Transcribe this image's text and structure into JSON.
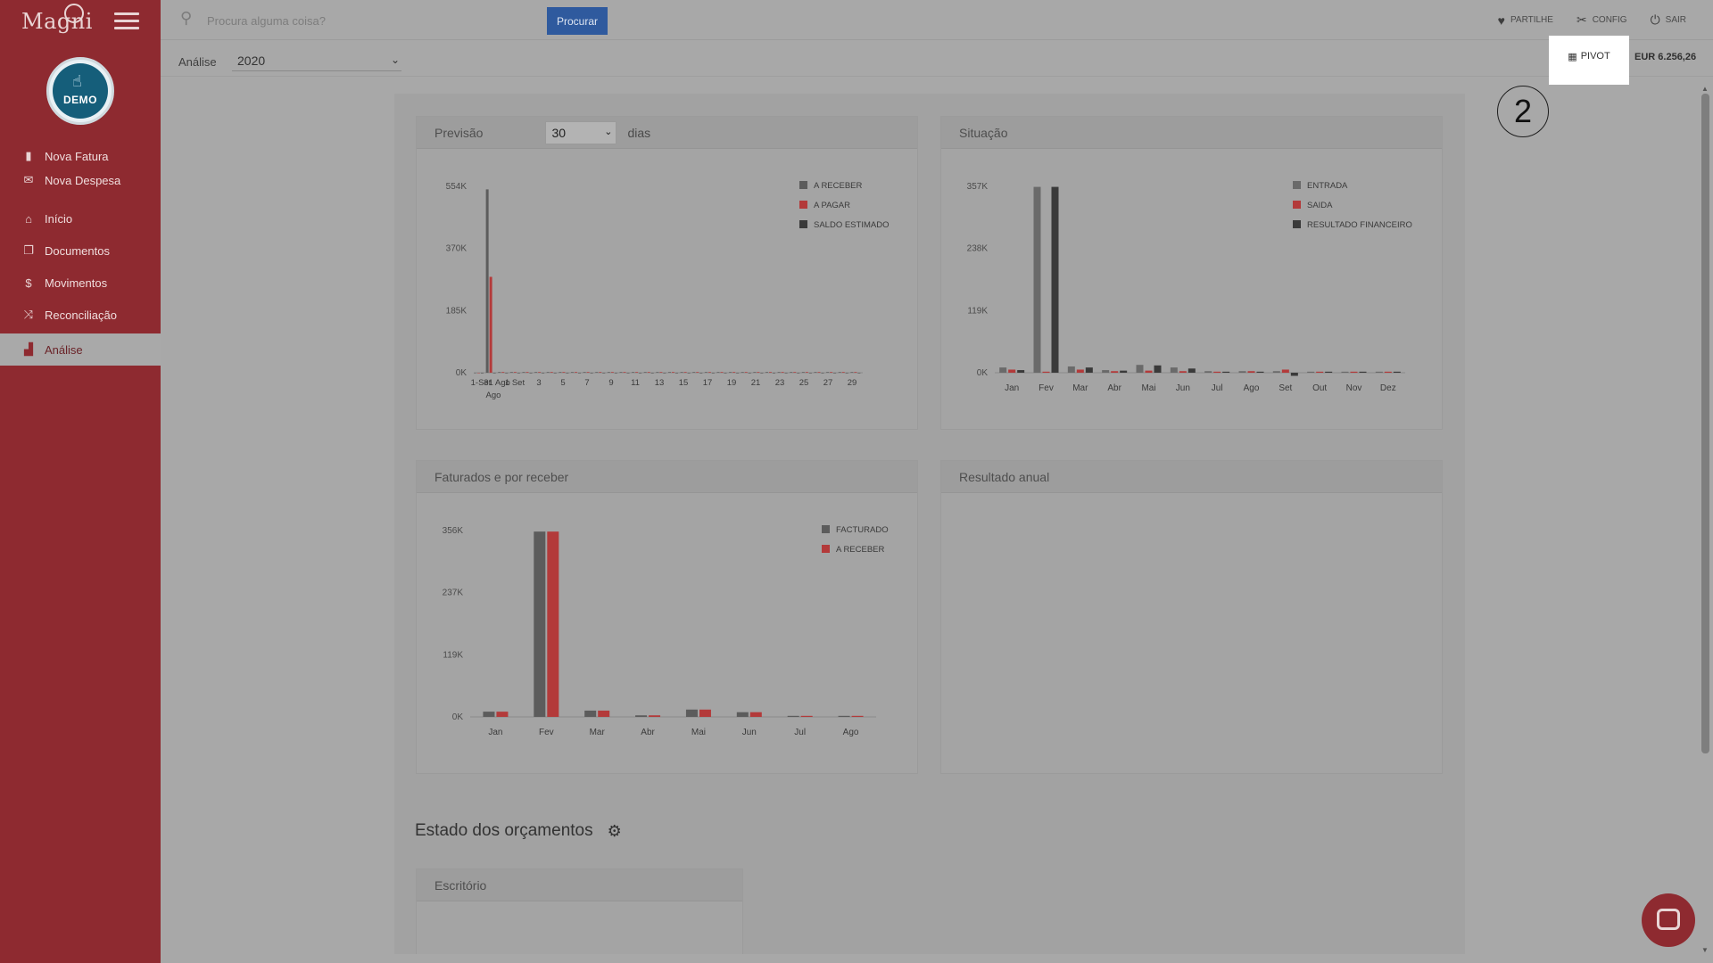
{
  "app": {
    "logo": "Magni",
    "avatar_label": "DEMO"
  },
  "sidebar": {
    "items": [
      {
        "label": "Nova Fatura",
        "icon": "document-icon"
      },
      {
        "label": "Nova Despesa",
        "icon": "receipt-icon"
      },
      {
        "label": "Início",
        "icon": "home-icon"
      },
      {
        "label": "Documentos",
        "icon": "documents-icon"
      },
      {
        "label": "Movimentos",
        "icon": "dollar-icon"
      },
      {
        "label": "Reconciliação",
        "icon": "shuffle-icon"
      },
      {
        "label": "Análise",
        "icon": "bar-chart-icon",
        "active": true
      }
    ]
  },
  "search": {
    "placeholder": "Procura alguma coisa?",
    "button": "Procurar"
  },
  "top_actions": {
    "share": "PARTILHE",
    "config": "CONFIG",
    "exit": "SAIR"
  },
  "subbar": {
    "label": "Análise",
    "year": "2020",
    "pivot": "PIVOT",
    "balance": "EUR 6.256,26"
  },
  "step_badge": "2",
  "cards": {
    "previsao": {
      "title": "Previsão",
      "days_value": "30",
      "days_label": "dias"
    },
    "situacao": {
      "title": "Situação"
    },
    "faturados": {
      "title": "Faturados e por receber"
    },
    "resultado": {
      "title": "Resultado anual"
    }
  },
  "budget": {
    "title": "Estado dos orçamentos",
    "card_title": "Escritório"
  },
  "chart_data": [
    {
      "type": "bar",
      "name": "previsao",
      "x_tick_labels": [
        "1-Set",
        "31 Ago",
        "1 Set",
        "3",
        "5",
        "7",
        "9",
        "11",
        "13",
        "15",
        "17",
        "19",
        "21",
        "23",
        "25",
        "27",
        "29"
      ],
      "y_tick_labels": [
        "0K",
        "185K",
        "370K",
        "554K"
      ],
      "ylim": [
        0,
        554
      ],
      "legend": [
        "A RECEBER",
        "A PAGAR",
        "SALDO ESTIMADO"
      ],
      "colors": [
        "#5c5c5c",
        "#b33a3a",
        "#3a3a3a"
      ],
      "series": [
        {
          "name": "A RECEBER",
          "values": [
            0,
            545,
            2,
            2,
            2,
            2,
            2,
            2,
            2,
            2,
            2,
            2,
            2,
            2,
            2,
            2,
            2,
            2,
            2,
            2,
            2,
            2,
            2,
            2,
            2,
            2,
            2,
            2,
            2,
            2,
            2,
            2
          ]
        },
        {
          "name": "A PAGAR",
          "values": [
            0,
            285,
            2,
            2,
            2,
            2,
            2,
            2,
            2,
            2,
            2,
            2,
            2,
            2,
            2,
            2,
            2,
            2,
            2,
            2,
            2,
            2,
            2,
            2,
            2,
            2,
            2,
            2,
            2,
            2,
            2,
            2
          ]
        },
        {
          "name": "SALDO ESTIMADO",
          "values": [
            0,
            0,
            0,
            0,
            0,
            0,
            0,
            0,
            0,
            0,
            0,
            0,
            0,
            0,
            0,
            0,
            0,
            0,
            0,
            0,
            0,
            0,
            0,
            0,
            0,
            0,
            0,
            0,
            0,
            0,
            0,
            0
          ]
        }
      ]
    },
    {
      "type": "bar",
      "name": "situacao",
      "categories": [
        "Jan",
        "Fev",
        "Mar",
        "Abr",
        "Mai",
        "Jun",
        "Jul",
        "Ago",
        "Set",
        "Out",
        "Nov",
        "Dez"
      ],
      "y_tick_labels": [
        "0K",
        "119K",
        "238K",
        "357K"
      ],
      "ylim": [
        0,
        357
      ],
      "legend": [
        "ENTRADA",
        "SAIDA",
        "RESULTADO FINANCEIRO"
      ],
      "colors": [
        "#6a6a6a",
        "#b33a3a",
        "#3a3a3a"
      ],
      "series": [
        {
          "name": "ENTRADA",
          "values": [
            10,
            356,
            12,
            5,
            15,
            10,
            3,
            3,
            3,
            2,
            2,
            2
          ]
        },
        {
          "name": "SAIDA",
          "values": [
            6,
            2,
            6,
            3,
            4,
            3,
            2,
            3,
            6,
            2,
            2,
            2
          ]
        },
        {
          "name": "RESULTADO FINANCEIRO",
          "values": [
            5,
            356,
            10,
            4,
            14,
            8,
            2,
            2,
            -6,
            2,
            2,
            2
          ]
        }
      ]
    },
    {
      "type": "bar",
      "name": "faturados",
      "categories": [
        "Jan",
        "Fev",
        "Mar",
        "Abr",
        "Mai",
        "Jun",
        "Jul",
        "Ago"
      ],
      "y_tick_labels": [
        "0K",
        "119K",
        "237K",
        "356K"
      ],
      "ylim": [
        0,
        356
      ],
      "legend": [
        "FACTURADO",
        "A RECEBER"
      ],
      "colors": [
        "#5c5c5c",
        "#b33a3a"
      ],
      "series": [
        {
          "name": "FACTURADO",
          "values": [
            10,
            354,
            12,
            3,
            14,
            9,
            2,
            2
          ]
        },
        {
          "name": "A RECEBER",
          "values": [
            10,
            354,
            12,
            3,
            14,
            9,
            2,
            2
          ]
        }
      ]
    }
  ]
}
